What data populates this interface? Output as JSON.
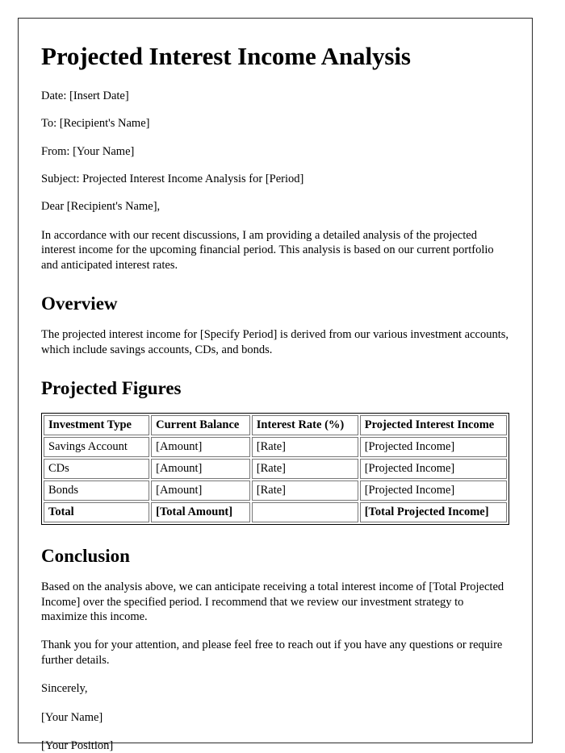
{
  "document": {
    "title": "Projected Interest Income Analysis",
    "header_fields": [
      "Date: [Insert Date]",
      "To: [Recipient's Name]",
      "From: [Your Name]",
      "Subject: Projected Interest Income Analysis for [Period]"
    ],
    "salutation": "Dear [Recipient's Name],",
    "intro_paragraph": "In accordance with our recent discussions, I am providing a detailed analysis of the projected interest income for the upcoming financial period. This analysis is based on our current portfolio and anticipated interest rates.",
    "overview": {
      "heading": "Overview",
      "paragraph": "The projected interest income for [Specify Period] is derived from our various investment accounts, which include savings accounts, CDs, and bonds."
    },
    "projected_figures": {
      "heading": "Projected Figures",
      "table": {
        "columns": [
          "Investment Type",
          "Current Balance",
          "Interest Rate (%)",
          "Projected Interest Income"
        ],
        "rows": [
          [
            "Savings Account",
            "[Amount]",
            "[Rate]",
            "[Projected Income]"
          ],
          [
            "CDs",
            "[Amount]",
            "[Rate]",
            "[Projected Income]"
          ],
          [
            "Bonds",
            "[Amount]",
            "[Rate]",
            "[Projected Income]"
          ]
        ],
        "total_row": [
          "Total",
          "[Total Amount]",
          "",
          "[Total Projected Income]"
        ]
      }
    },
    "conclusion": {
      "heading": "Conclusion",
      "paragraph_1": "Based on the analysis above, we can anticipate receiving a total interest income of [Total Projected Income] over the specified period. I recommend that we review our investment strategy to maximize this income.",
      "paragraph_2": "Thank you for your attention, and please feel free to reach out if you have any questions or require further details."
    },
    "closing": {
      "sign_off": "Sincerely,",
      "name": "[Your Name]",
      "position": "[Your Position]"
    }
  }
}
